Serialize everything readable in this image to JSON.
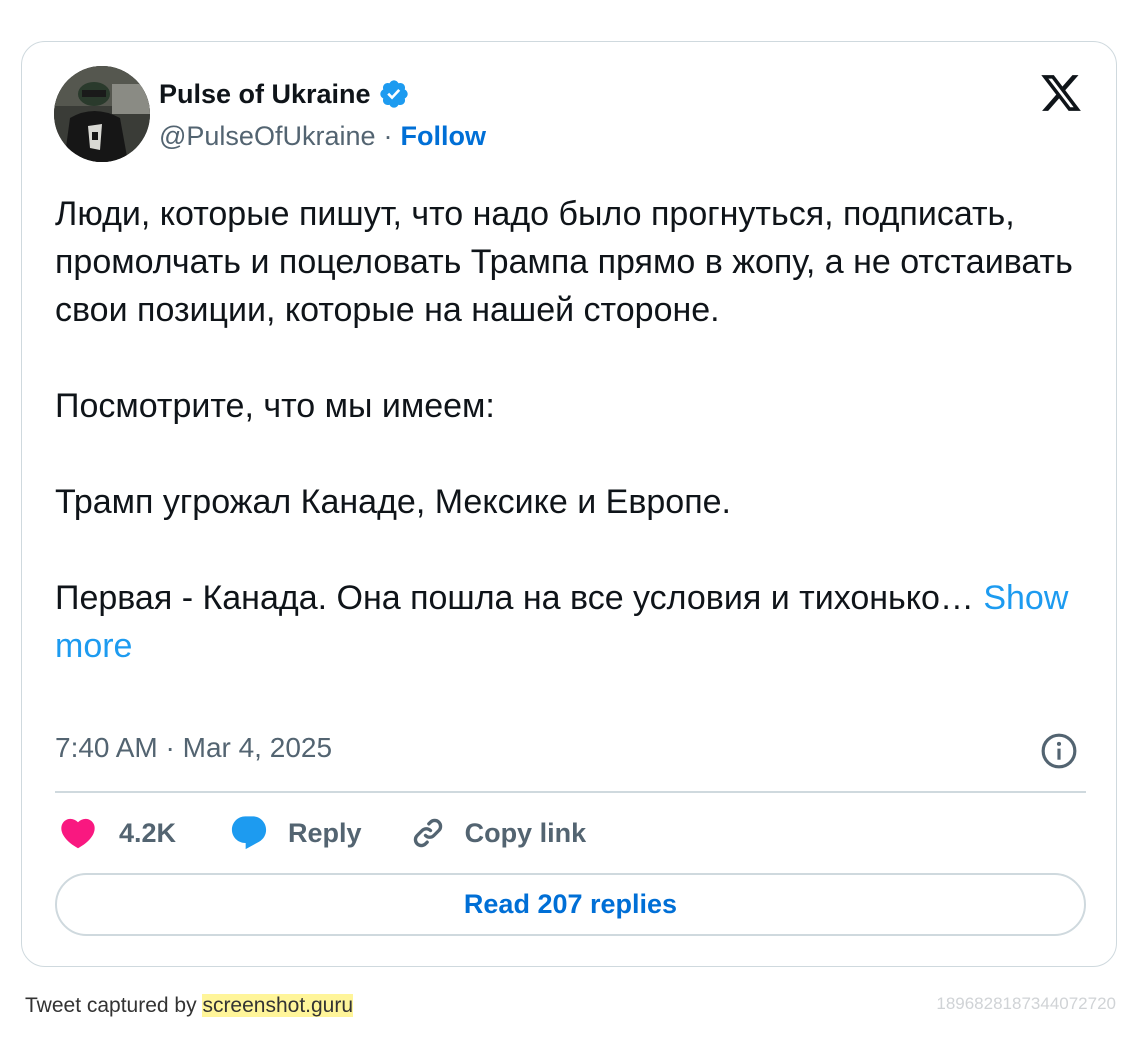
{
  "author": {
    "name": "Pulse of Ukraine",
    "handle": "@PulseOfUkraine",
    "separator": "·",
    "follow_label": "Follow"
  },
  "tweet": {
    "text": "Люди, которые пишут, что надо было прогнуться, подписать, промолчать и поцеловать Трампа прямо в жопу, а не отстаивать свои позиции, которые на нашей стороне.\n\nПосмотрите, что мы имеем:\n\nТрамп угрожал Канаде, Мексике и Европе.\n\nПервая - Канада. Она пошла на все условия и тихонько… ",
    "show_more": "Show more",
    "timestamp": "7:40 AM · Mar 4, 2025"
  },
  "actions": {
    "like_count": "4.2K",
    "reply_label": "Reply",
    "copy_label": "Copy link"
  },
  "read_replies_label": "Read 207 replies",
  "footer": {
    "captured_prefix": "Tweet captured by ",
    "captured_link": "screenshot.guru",
    "tweet_id": "1896828187344072720"
  },
  "colors": {
    "link_blue": "#006fd6",
    "show_more_blue": "#1d9bf0",
    "like_pink": "#f91880",
    "reply_blue": "#1d9bf0",
    "muted_text": "#536471",
    "border": "#cfd9de",
    "verified_blue": "#1d9bf0",
    "footer_highlight": "#fff59a"
  },
  "icons": {
    "verified": "verified-badge-icon",
    "logo": "x-logo-icon",
    "info": "info-icon",
    "like": "heart-icon",
    "reply": "speech-bubble-icon",
    "copy": "link-icon"
  }
}
